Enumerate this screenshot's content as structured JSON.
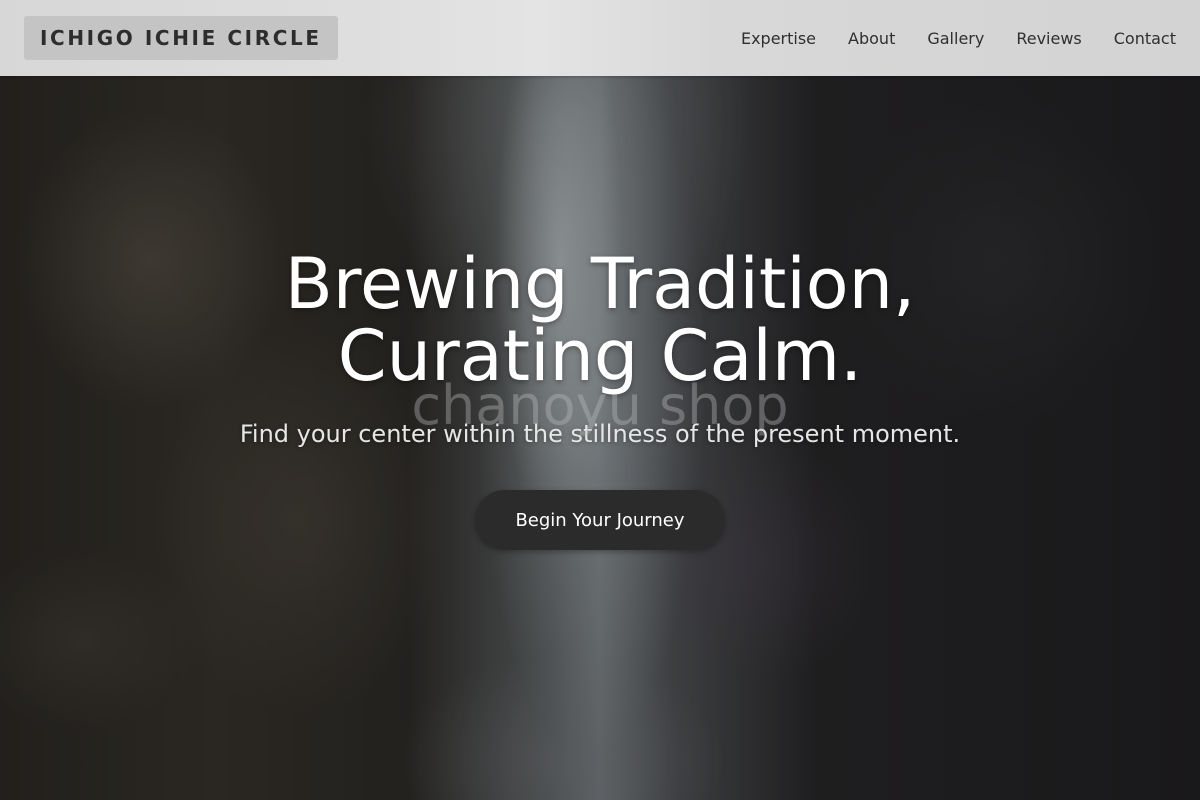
{
  "header": {
    "logo_text": "ICHIGO ICHIE CIRCLE",
    "nav_items": [
      {
        "label": "Expertise"
      },
      {
        "label": "About"
      },
      {
        "label": "Gallery"
      },
      {
        "label": "Reviews"
      },
      {
        "label": "Contact"
      }
    ]
  },
  "hero": {
    "title_line_1": "Brewing Tradition,",
    "title_line_2": "Curating Calm.",
    "watermark": "chanoyu shop",
    "subtitle": "Find your center within the stillness of the present moment.",
    "cta_label": "Begin Your Journey",
    "background_image": "waterfall-gorge-photo"
  },
  "colors": {
    "header_bg": "#dddddd",
    "logo_bg": "#c4c4c4",
    "text_dark": "#2f2f2f",
    "cta_bg": "#2b2b2b",
    "hero_text": "#ffffff"
  }
}
